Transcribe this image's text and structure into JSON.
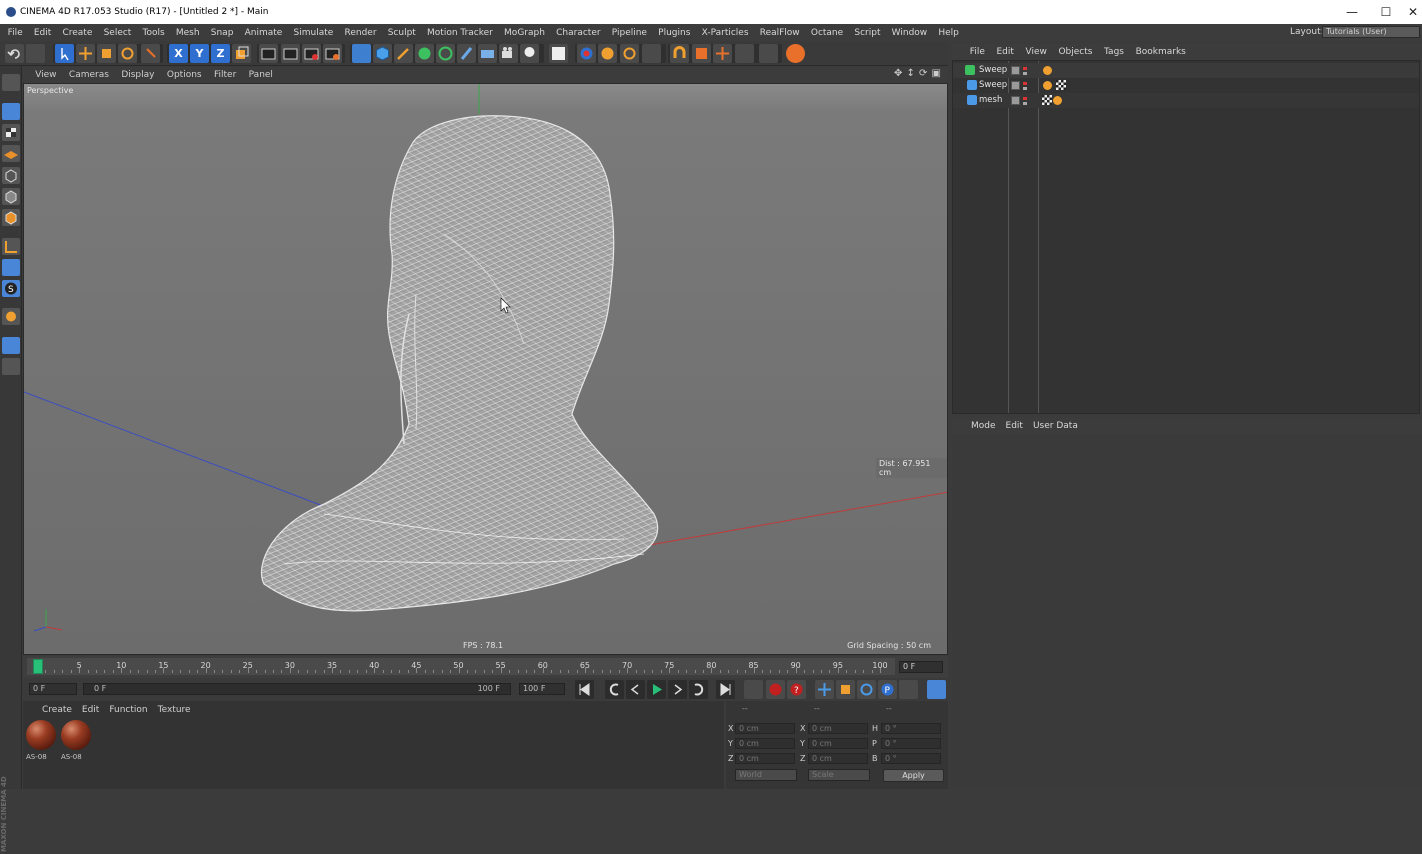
{
  "window": {
    "title": "CINEMA 4D R17.053 Studio (R17) - [Untitled 2 *] - Main",
    "controls": {
      "minimize": "—",
      "maximize": "☐",
      "close": "✕"
    }
  },
  "menubar": [
    "File",
    "Edit",
    "Create",
    "Select",
    "Tools",
    "Mesh",
    "Snap",
    "Animate",
    "Simulate",
    "Render",
    "Sculpt",
    "Motion Tracker",
    "MoGraph",
    "Character",
    "Pipeline",
    "Plugins",
    "X-Particles",
    "RealFlow",
    "Octane",
    "Script",
    "Window",
    "Help"
  ],
  "layout": {
    "label": "Layout:",
    "value": "Tutorials (User)"
  },
  "viewport": {
    "menu": [
      "View",
      "Cameras",
      "Display",
      "Options",
      "Filter",
      "Panel"
    ],
    "camera_label": "Perspective",
    "distance": "Dist : 67.951 cm",
    "fps": "FPS : 78.1",
    "grid_spacing": "Grid Spacing : 50 cm"
  },
  "timeline": {
    "ticks": [
      "0",
      "5",
      "10",
      "15",
      "20",
      "25",
      "30",
      "35",
      "40",
      "45",
      "50",
      "55",
      "60",
      "65",
      "70",
      "75",
      "80",
      "85",
      "90",
      "95",
      "100"
    ],
    "current_frame": "0 F"
  },
  "transport": {
    "start_frame": "0 F",
    "range_start": "0 F",
    "range_end": "100 F",
    "end_frame": "100 F"
  },
  "material_manager": {
    "menu": [
      "Create",
      "Edit",
      "Function",
      "Texture"
    ],
    "materials": [
      {
        "name": "AS-08"
      },
      {
        "name": "AS-08"
      }
    ]
  },
  "coordinates": {
    "header": [
      "--",
      "--",
      "--"
    ],
    "rows": [
      {
        "a_label": "X",
        "a": "0 cm",
        "b_label": "X",
        "b": "0 cm",
        "c_label": "H",
        "c": "0 °"
      },
      {
        "a_label": "Y",
        "a": "0 cm",
        "b_label": "Y",
        "b": "0 cm",
        "c_label": "P",
        "c": "0 °"
      },
      {
        "a_label": "Z",
        "a": "0 cm",
        "b_label": "Z",
        "b": "0 cm",
        "c_label": "B",
        "c": "0 °"
      }
    ],
    "world_select": "World",
    "scale_select": "Scale",
    "apply_label": "Apply"
  },
  "object_manager": {
    "menu": [
      "File",
      "Edit",
      "View",
      "Objects",
      "Tags",
      "Bookmarks"
    ],
    "objects": [
      {
        "name": "Sweep"
      },
      {
        "name": "Sweep"
      },
      {
        "name": "mesh"
      }
    ]
  },
  "attribute_manager": {
    "menu": [
      "Mode",
      "Edit",
      "User Data"
    ]
  },
  "branding": "MAXON CINEMA 4D",
  "colors": {
    "axis_x": "#c23a3a",
    "axis_y": "#3aa64a",
    "axis_z": "#3a4ec0",
    "accent_blue": "#2f6fd0",
    "timeline_cursor": "#28c078"
  }
}
